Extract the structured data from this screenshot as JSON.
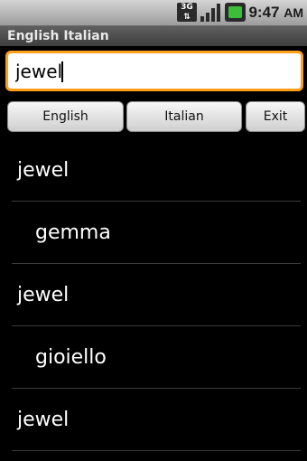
{
  "status_bar": {
    "network": "3G",
    "time": "9:47",
    "ampm": "AM"
  },
  "app": {
    "title": "English Italian"
  },
  "search": {
    "value": "jewel"
  },
  "buttons": {
    "english": "English",
    "italian": "Italian",
    "exit": "Exit"
  },
  "results": [
    {
      "text": "jewel",
      "level": 0
    },
    {
      "text": "gemma",
      "level": 1
    },
    {
      "text": "jewel",
      "level": 0
    },
    {
      "text": "gioiello",
      "level": 1
    },
    {
      "text": "jewel",
      "level": 0
    }
  ],
  "colors": {
    "focus_border": "#ff9f1a",
    "battery_fill": "#3bbf3b"
  }
}
